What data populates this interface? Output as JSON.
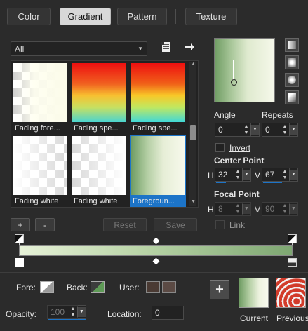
{
  "tabs": [
    {
      "label": "Color",
      "active": false
    },
    {
      "label": "Gradient",
      "active": true
    },
    {
      "label": "Pattern",
      "active": false
    },
    {
      "label": "Texture",
      "active": false
    }
  ],
  "presets": {
    "category": "All",
    "items": [
      {
        "label": "Fading fore..."
      },
      {
        "label": "Fading spe..."
      },
      {
        "label": "Fading spe..."
      },
      {
        "label": "Fading white"
      },
      {
        "label": "Fading white"
      },
      {
        "label": "Foregroun...",
        "selected": true
      }
    ],
    "add_label": "+",
    "remove_label": "-",
    "reset_label": "Reset",
    "save_label": "Save"
  },
  "angle": {
    "label": "Angle",
    "value": "0"
  },
  "repeats": {
    "label": "Repeats",
    "value": "0"
  },
  "invert": {
    "label": "Invert",
    "checked": false
  },
  "center_point": {
    "label": "Center Point",
    "h_label": "H",
    "h_value": "32",
    "v_label": "V",
    "v_value": "67"
  },
  "focal_point": {
    "label": "Focal Point",
    "h_label": "H",
    "h_value": "8",
    "v_label": "V",
    "v_value": "90"
  },
  "link": {
    "label": "Link",
    "checked": false
  },
  "bottom": {
    "fore_label": "Fore:",
    "back_label": "Back:",
    "user_label": "User:",
    "opacity_label": "Opacity:",
    "opacity_value": "100",
    "location_label": "Location:",
    "location_value": "0",
    "current_label": "Current",
    "previous_label": "Previous"
  },
  "colors": {
    "accent": "#1c74c8",
    "gradient_dark": "#7ea772",
    "gradient_light": "#e7f2d8",
    "user_swatch_1": "#4a3a33",
    "user_swatch_2": "#5b4a44"
  },
  "icons": [
    "new-gradient-icon",
    "arrow-right-icon",
    "linear-style-icon",
    "rectangular-style-icon",
    "sunburst-style-icon",
    "radial-style-icon"
  ]
}
